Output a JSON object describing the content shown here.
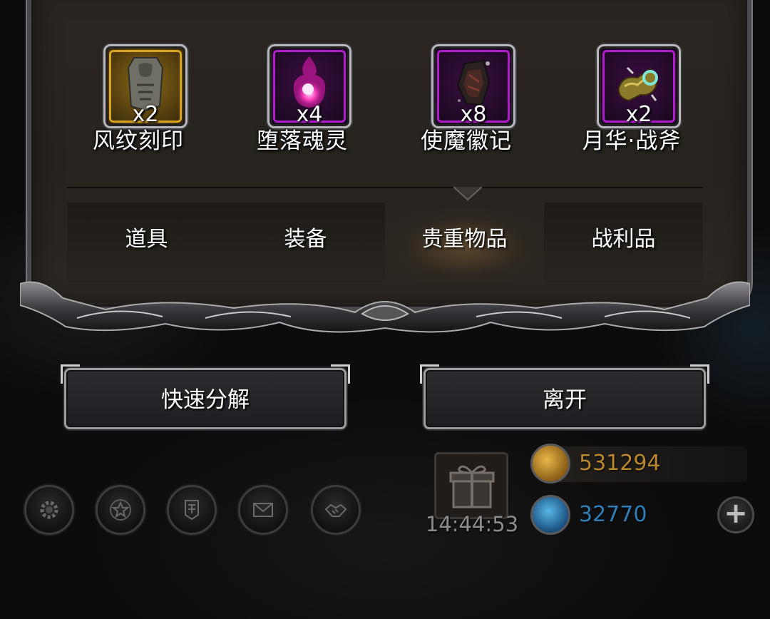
{
  "items": [
    {
      "name": "风纹刻印",
      "count": "x2",
      "rarity": "gold",
      "icon": "engraved-seal-icon"
    },
    {
      "name": "堕落魂灵",
      "count": "x4",
      "rarity": "purple",
      "icon": "fallen-soul-icon"
    },
    {
      "name": "使魔徽记",
      "count": "x8",
      "rarity": "purple",
      "icon": "familiar-emblem-icon"
    },
    {
      "name": "月华·战斧",
      "count": "x2",
      "rarity": "purple",
      "icon": "moonlight-axe-icon"
    }
  ],
  "tabs": [
    {
      "label": "道具",
      "active": false
    },
    {
      "label": "装备",
      "active": false
    },
    {
      "label": "贵重物品",
      "active": true
    },
    {
      "label": "战利品",
      "active": false
    }
  ],
  "buttons": {
    "quick_dismantle": "快速分解",
    "leave": "离开"
  },
  "bottom_icons": [
    "settings-gear-icon",
    "achievement-star-icon",
    "guild-banner-icon",
    "mail-icon",
    "handshake-icon"
  ],
  "gift": {
    "icon": "gift-box-icon",
    "timer": "14:44:53"
  },
  "currency": {
    "gold": "531294",
    "gems": "32770",
    "gold_color": "#b8862c",
    "gem_color": "#2e7fb6"
  },
  "colors": {
    "rarity_gold": "#d9a521",
    "rarity_purple": "#b01ccc"
  }
}
